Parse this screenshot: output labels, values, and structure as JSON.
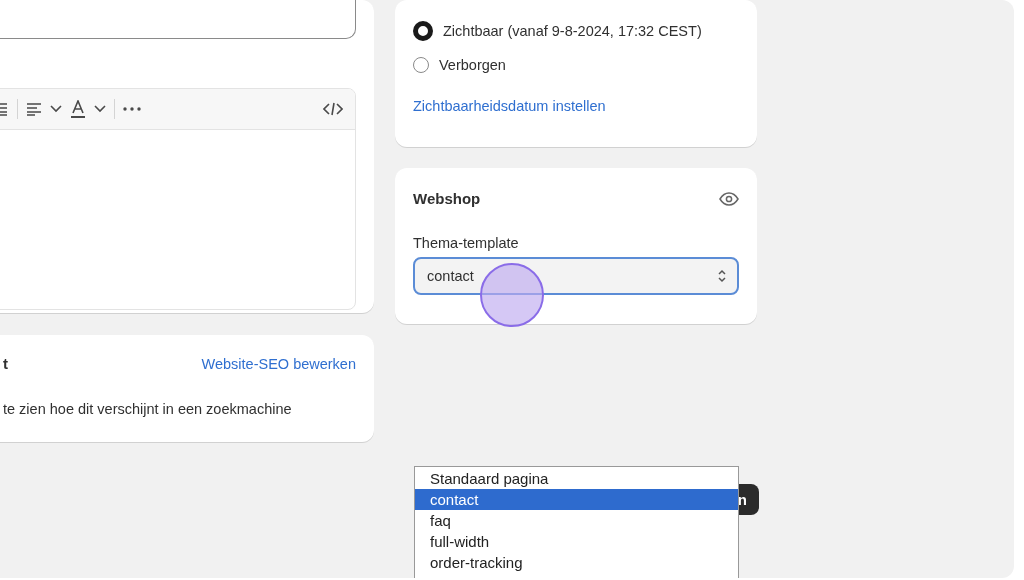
{
  "seo_card": {
    "heading": "t",
    "link": "Website-SEO bewerken",
    "description": "te zien hoe dit verschijnt in een zoekmachine"
  },
  "visibility_card": {
    "options": [
      {
        "label": "Zichtbaar (vanaf 9-8-2024, 17:32 CEST)",
        "selected": true
      },
      {
        "label": "Verborgen",
        "selected": false
      }
    ],
    "link": "Zichtbaarheidsdatum instellen"
  },
  "webshop_card": {
    "title": "Webshop",
    "template_label": "Thema-template",
    "template_value": "contact"
  },
  "covered_button": {
    "label": "n"
  },
  "dropdown": {
    "options": [
      {
        "label": "Standaard pagina",
        "selected": false
      },
      {
        "label": "contact",
        "selected": true
      },
      {
        "label": "faq",
        "selected": false
      },
      {
        "label": "full-width",
        "selected": false
      },
      {
        "label": "order-tracking",
        "selected": false
      }
    ]
  }
}
